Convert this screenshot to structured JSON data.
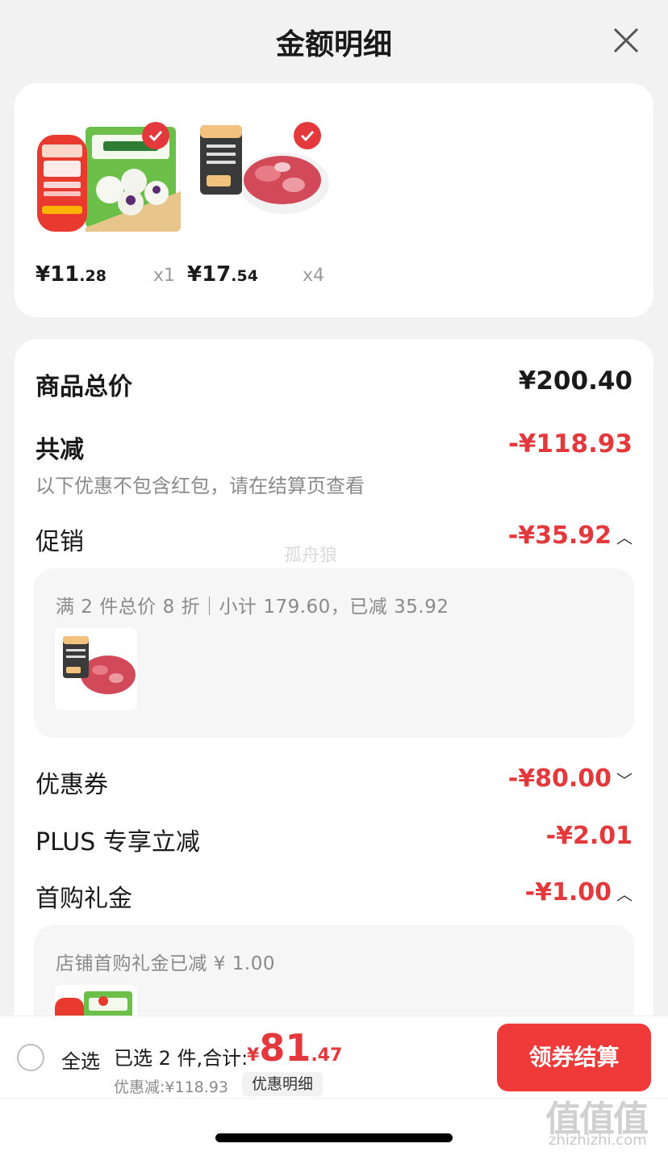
{
  "header": {
    "title": "金额明细",
    "close_icon": "close-icon"
  },
  "products": [
    {
      "price_int": "¥11",
      "price_dec": ".28",
      "qty": "x1",
      "checked": true
    },
    {
      "price_int": "¥17",
      "price_dec": ".54",
      "qty": "x4",
      "checked": true
    }
  ],
  "summary": {
    "goods_total_label": "商品总价",
    "goods_total_value": "¥200.40",
    "total_reduce_label": "共减",
    "total_reduce_value": "-¥118.93",
    "note": "以下优惠不包含红包，请在结算页查看"
  },
  "promotion": {
    "label": "促销",
    "value": "-¥35.92",
    "expanded": true,
    "detail": "满 2 件总价 8 折｜小计 179.60，已减 35.92"
  },
  "coupon": {
    "label": "优惠券",
    "value": "-¥80.00",
    "expanded": false
  },
  "plus": {
    "label": "PLUS 专享立减",
    "value": "-¥2.01"
  },
  "first_purchase": {
    "label": "首购礼金",
    "value": "-¥1.00",
    "expanded": true,
    "detail": "店铺首购礼金已减 ¥ 1.00"
  },
  "footer": {
    "select_all": "全选",
    "selected_text": "已选 2 件,合计:",
    "total_currency": "¥",
    "total_int": "81",
    "total_dec": ".47",
    "discount_text": "优惠减:¥118.93",
    "discount_detail_button": "优惠明细",
    "checkout_button": "领券结算"
  },
  "watermarks": {
    "center": "孤舟狼",
    "brand": "值值值",
    "site": "zhizhizhi.com"
  },
  "colors": {
    "accent_red": "#e4393c",
    "button_red": "#f03a3a"
  }
}
